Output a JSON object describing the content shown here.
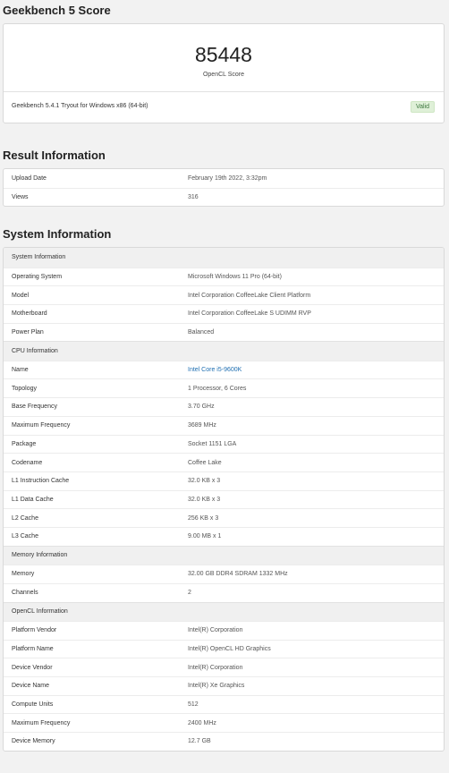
{
  "score_section": {
    "heading": "Geekbench 5 Score",
    "score": "85448",
    "score_label": "OpenCL Score",
    "version": "Geekbench 5.4.1 Tryout for Windows x86 (64-bit)",
    "badge": "Valid"
  },
  "result": {
    "heading": "Result Information",
    "rows": [
      {
        "key": "Upload Date",
        "value": "February 19th 2022, 3:32pm"
      },
      {
        "key": "Views",
        "value": "316"
      }
    ]
  },
  "system": {
    "heading": "System Information",
    "sections": [
      {
        "title": "System Information",
        "rows": [
          {
            "key": "Operating System",
            "value": "Microsoft Windows 11 Pro (64-bit)"
          },
          {
            "key": "Model",
            "value": "Intel Corporation CoffeeLake Client Platform"
          },
          {
            "key": "Motherboard",
            "value": "Intel Corporation CoffeeLake S UDIMM RVP"
          },
          {
            "key": "Power Plan",
            "value": "Balanced"
          }
        ]
      },
      {
        "title": "CPU Information",
        "rows": [
          {
            "key": "Name",
            "value": "Intel Core i5-9600K"
          },
          {
            "key": "Topology",
            "value": "1 Processor, 6 Cores"
          },
          {
            "key": "Base Frequency",
            "value": "3.70 GHz"
          },
          {
            "key": "Maximum Frequency",
            "value": "3689 MHz"
          },
          {
            "key": "Package",
            "value": "Socket 1151 LGA"
          },
          {
            "key": "Codename",
            "value": "Coffee Lake"
          },
          {
            "key": "L1 Instruction Cache",
            "value": "32.0 KB x 3"
          },
          {
            "key": "L1 Data Cache",
            "value": "32.0 KB x 3"
          },
          {
            "key": "L2 Cache",
            "value": "256 KB x 3"
          },
          {
            "key": "L3 Cache",
            "value": "9.00 MB x 1"
          }
        ]
      },
      {
        "title": "Memory Information",
        "rows": [
          {
            "key": "Memory",
            "value": "32.00 GB DDR4 SDRAM 1332 MHz"
          },
          {
            "key": "Channels",
            "value": "2"
          }
        ]
      },
      {
        "title": "OpenCL Information",
        "rows": [
          {
            "key": "Platform Vendor",
            "value": "Intel(R) Corporation"
          },
          {
            "key": "Platform Name",
            "value": "Intel(R) OpenCL HD Graphics"
          },
          {
            "key": "Device Vendor",
            "value": "Intel(R) Corporation"
          },
          {
            "key": "Device Name",
            "value": "Intel(R) Xe Graphics"
          },
          {
            "key": "Compute Units",
            "value": "512"
          },
          {
            "key": "Maximum Frequency",
            "value": "2400 MHz"
          },
          {
            "key": "Device Memory",
            "value": "12.7 GB"
          }
        ]
      }
    ]
  },
  "colors": {
    "link": "#1f6fb2",
    "valid_bg": "#dff0d8",
    "valid_text": "#3c763d",
    "section_bg": "#f0f0f0"
  }
}
